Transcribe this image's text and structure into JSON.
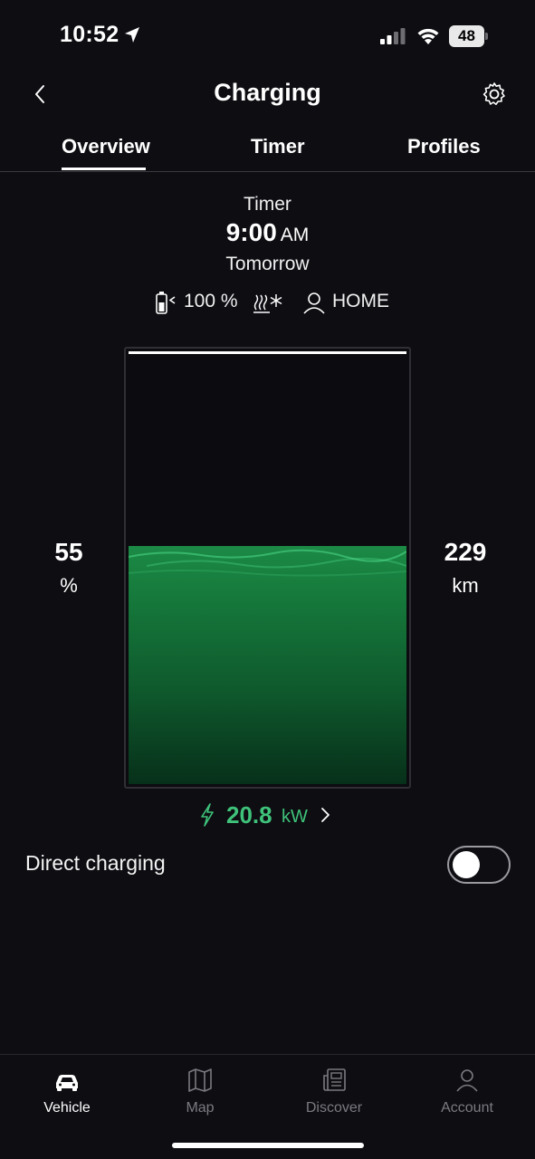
{
  "status_bar": {
    "time": "10:52",
    "battery_level": "48",
    "icons": [
      "location-arrow-icon",
      "cellular-signal-icon",
      "wifi-icon",
      "battery-icon"
    ]
  },
  "header": {
    "title": "Charging",
    "back_icon": "chevron-left-icon",
    "settings_icon": "gear-icon"
  },
  "tabs": [
    {
      "label": "Overview",
      "active": true
    },
    {
      "label": "Timer",
      "active": false
    },
    {
      "label": "Profiles",
      "active": false
    }
  ],
  "timer": {
    "label": "Timer",
    "time": "9:00",
    "ampm": "AM",
    "day": "Tomorrow",
    "target_soc": "100 %",
    "location": "HOME"
  },
  "battery": {
    "soc_value": "55",
    "soc_unit": "%",
    "range_value": "229",
    "range_unit": "km",
    "fill_fraction": 0.55,
    "target_fraction": 1.0,
    "fill_color": "#1c8a46"
  },
  "charging_power": {
    "value": "20.8",
    "unit": "kW",
    "accent_color": "#3fc27a"
  },
  "direct_charging": {
    "label": "Direct charging",
    "enabled": false
  },
  "bottom_nav": [
    {
      "label": "Vehicle",
      "icon": "car-icon",
      "active": true
    },
    {
      "label": "Map",
      "icon": "map-icon",
      "active": false
    },
    {
      "label": "Discover",
      "icon": "news-icon",
      "active": false
    },
    {
      "label": "Account",
      "icon": "person-icon",
      "active": false
    }
  ]
}
